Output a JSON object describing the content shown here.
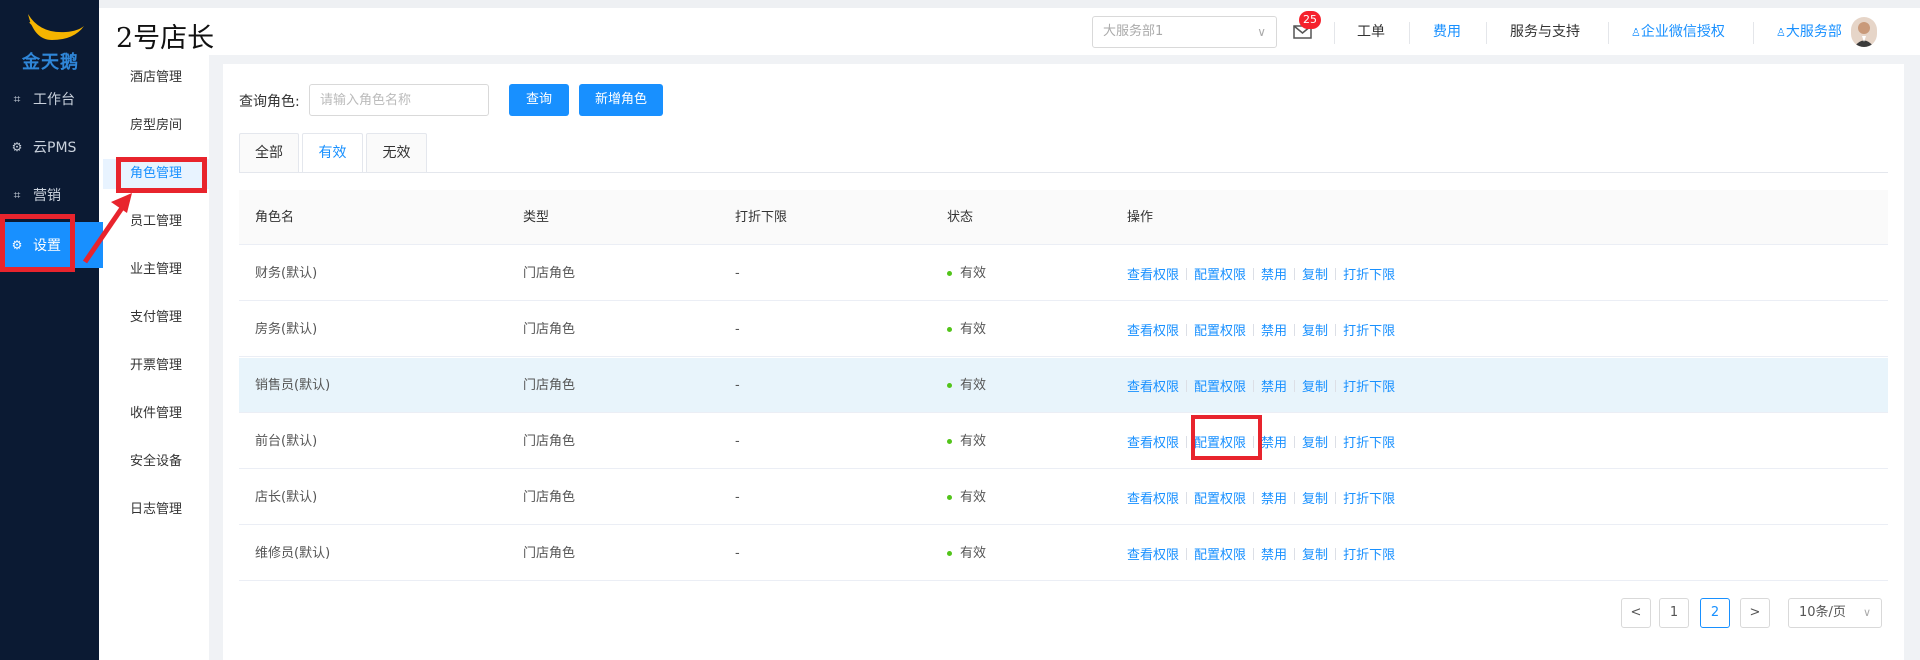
{
  "brand": {
    "logo_text": "金天鹅",
    "colors": {
      "sidebar": "#0b1a33",
      "primary": "#1890ff",
      "annotation": "#e8242d",
      "status_ok": "#52c41a"
    }
  },
  "nav": [
    {
      "label": "工作台",
      "icon": "workbench-icon"
    },
    {
      "label": "云PMS",
      "icon": "gear-icon"
    },
    {
      "label": "营销",
      "icon": "marketing-icon"
    },
    {
      "label": "设置",
      "icon": "gear-icon",
      "active": true
    }
  ],
  "subnav": [
    "酒店管理",
    "房型房间",
    "角色管理",
    "员工管理",
    "业主管理",
    "支付管理",
    "开票管理",
    "收件管理",
    "安全设备",
    "日志管理"
  ],
  "header": {
    "store_title": "2号店长",
    "dept_select": "大服务部1",
    "mail_badge": "25",
    "links": [
      "工单",
      "费用",
      "服务与支持",
      "企业微信授权",
      "大服务部"
    ]
  },
  "search": {
    "label": "查询角色:",
    "placeholder": "请输入角色名称",
    "query_btn": "查询",
    "add_btn": "新增角色"
  },
  "tabs": [
    "全部",
    "有效",
    "无效"
  ],
  "table": {
    "headers": [
      "角色名",
      "类型",
      "打折下限",
      "状态",
      "操作"
    ],
    "ops": [
      "查看权限",
      "配置权限",
      "禁用",
      "复制",
      "打折下限"
    ],
    "rows": [
      {
        "name": "财务(默认)",
        "type": "门店角色",
        "discount": "-",
        "status": "有效"
      },
      {
        "name": "房务(默认)",
        "type": "门店角色",
        "discount": "-",
        "status": "有效"
      },
      {
        "name": "销售员(默认)",
        "type": "门店角色",
        "discount": "-",
        "status": "有效"
      },
      {
        "name": "前台(默认)",
        "type": "门店角色",
        "discount": "-",
        "status": "有效"
      },
      {
        "name": "店长(默认)",
        "type": "门店角色",
        "discount": "-",
        "status": "有效"
      },
      {
        "name": "维修员(默认)",
        "type": "门店角色",
        "discount": "-",
        "status": "有效"
      }
    ]
  },
  "pagination": {
    "prev": "<",
    "pages": [
      "1",
      "2"
    ],
    "current": "2",
    "next": ">",
    "size": "10条/页"
  }
}
